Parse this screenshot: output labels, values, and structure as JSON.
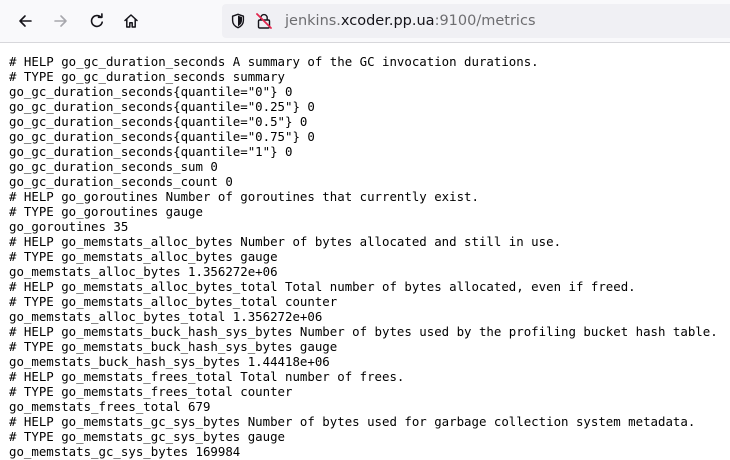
{
  "toolbar": {
    "back_icon": "back-arrow-icon",
    "forward_icon": "forward-arrow-icon",
    "reload_icon": "reload-icon",
    "home_icon": "home-icon",
    "colors": {
      "icon": "#15141a",
      "icon_disabled": "#a8a8ad",
      "insecure": "#e22850"
    }
  },
  "urlbar": {
    "shield_icon": "shield-icon",
    "insecure_lock_icon": "insecure-lock-icon",
    "url_prefix": "jenkins.",
    "url_host": "xcoder.pp.ua",
    "url_port": ":9100",
    "url_path": "/metrics"
  },
  "metrics": {
    "lines": [
      "# HELP go_gc_duration_seconds A summary of the GC invocation durations.",
      "# TYPE go_gc_duration_seconds summary",
      "go_gc_duration_seconds{quantile=\"0\"} 0",
      "go_gc_duration_seconds{quantile=\"0.25\"} 0",
      "go_gc_duration_seconds{quantile=\"0.5\"} 0",
      "go_gc_duration_seconds{quantile=\"0.75\"} 0",
      "go_gc_duration_seconds{quantile=\"1\"} 0",
      "go_gc_duration_seconds_sum 0",
      "go_gc_duration_seconds_count 0",
      "# HELP go_goroutines Number of goroutines that currently exist.",
      "# TYPE go_goroutines gauge",
      "go_goroutines 35",
      "# HELP go_memstats_alloc_bytes Number of bytes allocated and still in use.",
      "# TYPE go_memstats_alloc_bytes gauge",
      "go_memstats_alloc_bytes 1.356272e+06",
      "# HELP go_memstats_alloc_bytes_total Total number of bytes allocated, even if freed.",
      "# TYPE go_memstats_alloc_bytes_total counter",
      "go_memstats_alloc_bytes_total 1.356272e+06",
      "# HELP go_memstats_buck_hash_sys_bytes Number of bytes used by the profiling bucket hash table.",
      "# TYPE go_memstats_buck_hash_sys_bytes gauge",
      "go_memstats_buck_hash_sys_bytes 1.44418e+06",
      "# HELP go_memstats_frees_total Total number of frees.",
      "# TYPE go_memstats_frees_total counter",
      "go_memstats_frees_total 679",
      "# HELP go_memstats_gc_sys_bytes Number of bytes used for garbage collection system metadata.",
      "# TYPE go_memstats_gc_sys_bytes gauge",
      "go_memstats_gc_sys_bytes 169984"
    ]
  }
}
